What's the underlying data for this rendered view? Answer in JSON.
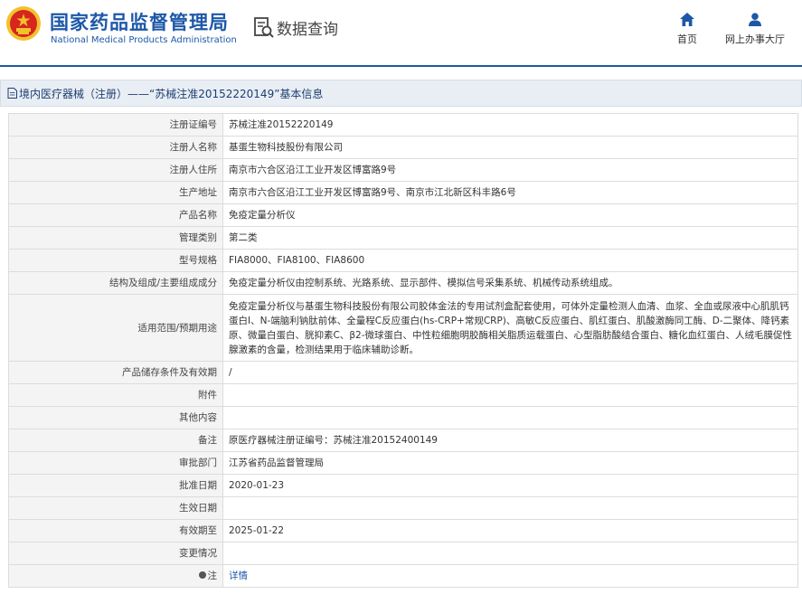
{
  "header": {
    "org_name_cn": "国家药品监督管理局",
    "org_name_en": "National Medical Products Administration",
    "section_title": "数据查询",
    "nav": {
      "home_label": "首页",
      "service_hall_label": "网上办事大厅"
    },
    "colors": {
      "brand": "#1d58a8",
      "emblem_red": "#d7261e",
      "emblem_gold": "#f2c12e"
    },
    "icons": {
      "emblem": "national-emblem-icon",
      "query": "document-search-icon",
      "home": "home-icon",
      "hall": "user-icon"
    }
  },
  "breadcrumb": {
    "text": "境内医疗器械（注册）——“苏械注准20152220149”基本信息",
    "icon": "document-icon"
  },
  "detail": {
    "rows": [
      {
        "label": "注册证编号",
        "value": "苏械注准20152220149"
      },
      {
        "label": "注册人名称",
        "value": "基蛋生物科技股份有限公司"
      },
      {
        "label": "注册人住所",
        "value": "南京市六合区沿江工业开发区博富路9号"
      },
      {
        "label": "生产地址",
        "value": "南京市六合区沿江工业开发区博富路9号、南京市江北新区科丰路6号"
      },
      {
        "label": "产品名称",
        "value": "免疫定量分析仪"
      },
      {
        "label": "管理类别",
        "value": "第二类"
      },
      {
        "label": "型号规格",
        "value": "FIA8000、FIA8100、FIA8600"
      },
      {
        "label": "结构及组成/主要组成成分",
        "value": "免疫定量分析仪由控制系统、光路系统、显示部件、模拟信号采集系统、机械传动系统组成。"
      },
      {
        "label": "适用范围/预期用途",
        "value": "免疫定量分析仪与基蛋生物科技股份有限公司胶体金法的专用试剂盒配套使用，可体外定量检测人血清、血浆、全血或尿液中心肌肌钙蛋白I、N-端脑利钠肽前体、全量程C反应蛋白(hs-CRP+常规CRP)、高敏C反应蛋白、肌红蛋白、肌酸激酶同工酶、D-二聚体、降钙素原、微量白蛋白、胱抑素C、β2-微球蛋白、中性粒细胞明胶酶相关脂质运载蛋白、心型脂肪酸结合蛋白、糖化血红蛋白、人绒毛膜促性腺激素的含量，检测结果用于临床辅助诊断。"
      },
      {
        "label": "产品储存条件及有效期",
        "value": "/"
      },
      {
        "label": "附件",
        "value": ""
      },
      {
        "label": "其他内容",
        "value": ""
      },
      {
        "label": "备注",
        "value": "原医疗器械注册证编号：苏械注准20152400149"
      },
      {
        "label": "审批部门",
        "value": "江苏省药品监督管理局"
      },
      {
        "label": "批准日期",
        "value": "2020-01-23"
      },
      {
        "label": "生效日期",
        "value": ""
      },
      {
        "label": "有效期至",
        "value": "2025-01-22"
      },
      {
        "label": "变更情况",
        "value": ""
      }
    ],
    "note": {
      "label": "注",
      "link_text": "详情",
      "icon": "note-icon"
    }
  }
}
